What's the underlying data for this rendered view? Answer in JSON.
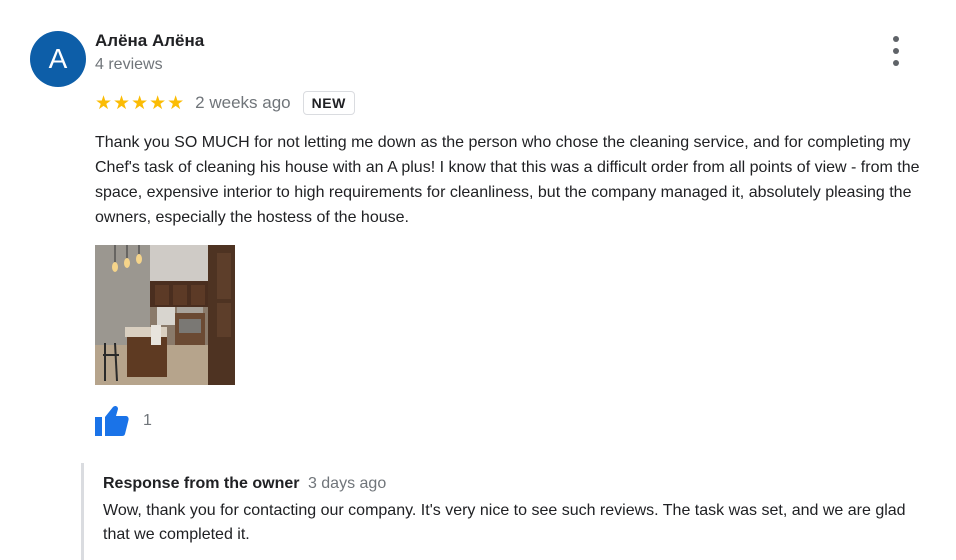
{
  "review": {
    "avatar_letter": "A",
    "reviewer_name": "Алёна Алёна",
    "reviewer_meta": "4 reviews",
    "rating": 5,
    "stars": "★★★★★",
    "date": "2 weeks ago",
    "badge": "NEW",
    "text": "Thank you SO MUCH for not letting me down as the person who chose the cleaning service, and for completing my Chef's task of cleaning his house with an A plus! I know that this was a difficult order from all points of view - from the space, expensive interior to high requirements for cleanliness, but the company managed it, absolutely pleasing the owners, especially the hostess of the house.",
    "like_count": "1"
  },
  "response": {
    "label": "Response from the owner",
    "date": "3 days ago",
    "text": "Wow, thank you for contacting our company. It's very nice to see such reviews. The task was set, and we are glad that we completed it."
  },
  "colors": {
    "avatar": "#0d5ea8",
    "star": "#fbbc04",
    "like": "#1a73e8",
    "secondary_text": "#70757a"
  },
  "icons": {
    "menu": "more-vert-icon",
    "like": "thumb-up-icon"
  }
}
